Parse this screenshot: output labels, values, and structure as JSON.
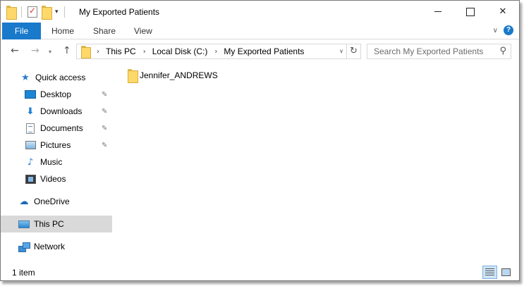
{
  "window": {
    "title": "My Exported Patients",
    "controls": {
      "minimize": "–",
      "maximize": "☐",
      "close": "✕"
    }
  },
  "ribbon": {
    "tabs": [
      "File",
      "Home",
      "Share",
      "View"
    ],
    "collapse_icon": "chevron-down-icon",
    "help_label": "?"
  },
  "navigation": {
    "back": "←",
    "forward": "→",
    "recent": "▾",
    "up": "↑",
    "breadcrumb": [
      "This PC",
      "Local Disk (C:)",
      "My Exported Patients"
    ],
    "refresh": "↻"
  },
  "search": {
    "placeholder": "Search My Exported Patients",
    "value": ""
  },
  "sidebar": {
    "items": [
      {
        "label": "Quick access",
        "icon": "star-icon",
        "pinned": false
      },
      {
        "label": "Desktop",
        "icon": "desktop-icon",
        "pinned": true
      },
      {
        "label": "Downloads",
        "icon": "downloads-icon",
        "pinned": true
      },
      {
        "label": "Documents",
        "icon": "documents-icon",
        "pinned": true
      },
      {
        "label": "Pictures",
        "icon": "pictures-icon",
        "pinned": true
      },
      {
        "label": "Music",
        "icon": "music-icon",
        "pinned": false
      },
      {
        "label": "Videos",
        "icon": "videos-icon",
        "pinned": false
      },
      {
        "label": "OneDrive",
        "icon": "onedrive-icon",
        "pinned": false
      },
      {
        "label": "This PC",
        "icon": "this-pc-icon",
        "pinned": false,
        "selected": true
      },
      {
        "label": "Network",
        "icon": "network-icon",
        "pinned": false
      }
    ],
    "pin_glyph": "📌"
  },
  "content": {
    "items": [
      {
        "name": "Jennifer_ANDREWS",
        "type": "folder"
      }
    ]
  },
  "statusbar": {
    "item_count": "1 item",
    "views": [
      "details-view-icon",
      "large-icons-view-icon"
    ]
  },
  "colors": {
    "accent": "#1979ca",
    "selected_bg": "#d9d9d9",
    "folder": "#ffd86a"
  }
}
